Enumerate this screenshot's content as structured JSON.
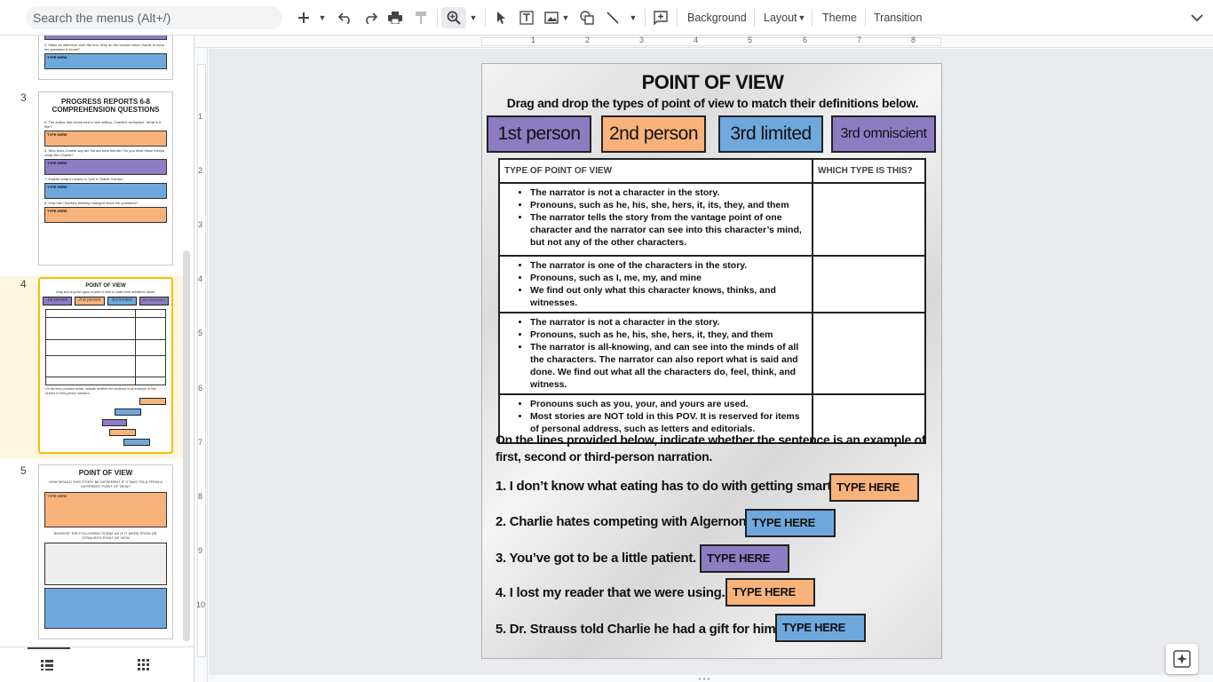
{
  "toolbar": {
    "search_placeholder": "Search the menus (Alt+/)",
    "background": "Background",
    "layout": "Layout",
    "theme": "Theme",
    "transition": "Transition"
  },
  "filmstrip": {
    "slides": [
      {
        "number": "3",
        "title": "PROGRESS REPORTS 6-8 COMPREHENSION QUESTIONS"
      },
      {
        "number": "4",
        "title": "POINT OF VIEW"
      },
      {
        "number": "5",
        "title": "POINT OF VIEW"
      }
    ],
    "thumb_box": "TYPE HERE"
  },
  "ruler": {
    "top": [
      "1",
      "2",
      "3",
      "4",
      "5",
      "6",
      "7",
      "8"
    ],
    "left": [
      "1",
      "2",
      "3",
      "4",
      "5",
      "6",
      "7",
      "8",
      "9",
      "10"
    ]
  },
  "slide": {
    "title": "POINT OF VIEW",
    "subtitle": "Drag and drop the types of point of view to match their definitions below.",
    "types": [
      "1st person",
      "2nd person",
      "3rd limited",
      "3rd omniscient"
    ],
    "table": {
      "headers": [
        "TYPE OF POINT OF VIEW",
        "WHICH TYPE IS THIS?"
      ],
      "rows": [
        [
          "The narrator is not a character in the story.",
          "Pronouns, such as he, his, she, hers, it, its, they, and them",
          "The narrator tells the story from the vantage point of one character and the narrator can see into this character’s mind, but not any of the other characters."
        ],
        [
          "The narrator is one of the characters in the story.",
          "Pronouns, such as I, me, my, and mine",
          "We find out only what this character knows, thinks, and witnesses."
        ],
        [
          "The narrator is not a character in the story.",
          "Pronouns, such as he, his, she, hers, it, they, and them",
          "The narrator is all-knowing, and can see into the minds of all the characters. The narrator can also report what is said and done. We find out what all the characters do, feel, think, and witness."
        ],
        [
          "Pronouns such as you, your, and yours are used.",
          "Most stories are NOT told in this POV. It is reserved for items of personal address, such as letters and editorials."
        ]
      ]
    },
    "instructions": "On the lines provided below, indicate whether the sentence is an example of first, second or third-person narration.",
    "questions": [
      "1. I don’t know what eating has to do with getting smart.",
      "2. Charlie hates competing with Algernon.",
      "3. You’ve got to be a little patient.",
      "4. I lost my reader that we were using.",
      "5. Dr. Strauss told Charlie he had a gift for him."
    ],
    "answer_placeholder": "TYPE HERE"
  },
  "colors": {
    "purple": "#8e7cc3",
    "orange": "#f9b27a",
    "blue": "#6fa8dc",
    "selection": "#fbbc04"
  }
}
